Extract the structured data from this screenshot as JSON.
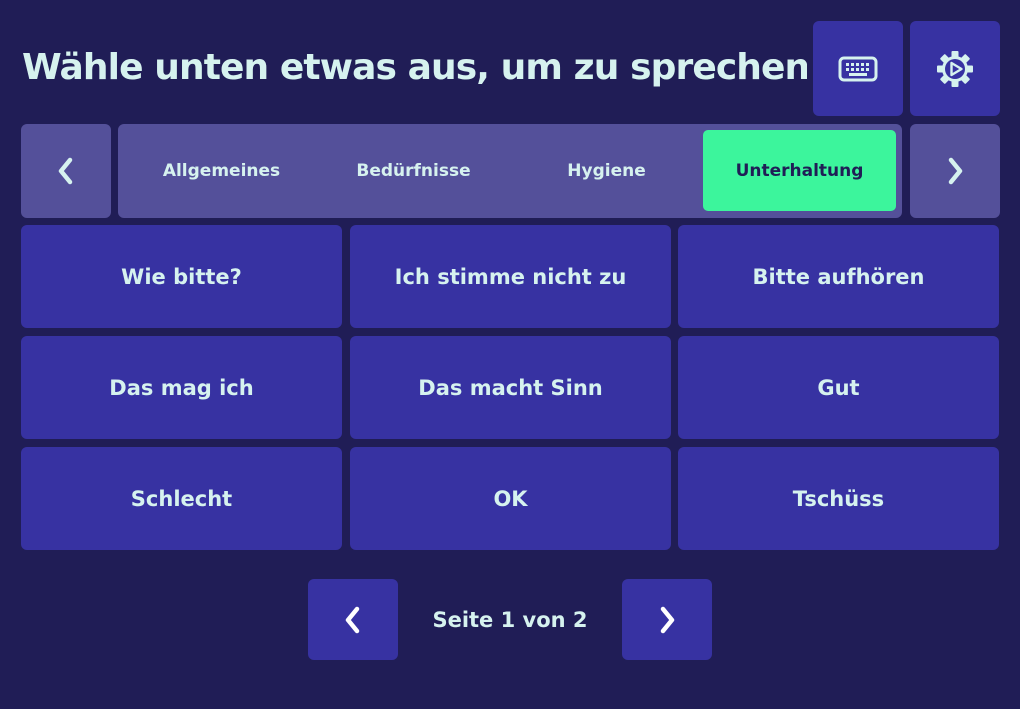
{
  "header": {
    "title": "Wähle unten etwas aus, um zu sprechen",
    "keyboard_icon": "keyboard-icon",
    "settings_icon": "gear-play-icon"
  },
  "categories": {
    "prev_icon": "chevron-left-icon",
    "next_icon": "chevron-right-icon",
    "tabs": [
      {
        "label": "Allgemeines",
        "active": false
      },
      {
        "label": "Bedürfnisse",
        "active": false
      },
      {
        "label": "Hygiene",
        "active": false
      },
      {
        "label": "Unterhaltung",
        "active": true
      }
    ]
  },
  "phrases": [
    "Wie bitte?",
    "Ich stimme nicht zu",
    "Bitte aufhören",
    "Das mag ich",
    "Das macht Sinn",
    "Gut",
    "Schlecht",
    "OK",
    "Tschüss"
  ],
  "pagination": {
    "label": "Seite 1 von 2",
    "prev_icon": "chevron-left-icon",
    "next_icon": "chevron-right-icon"
  },
  "colors": {
    "background": "#201d56",
    "button": "#3732a2",
    "tab_strip": "#54509a",
    "active_tab": "#3cf59c",
    "text": "#d6f2ef"
  }
}
